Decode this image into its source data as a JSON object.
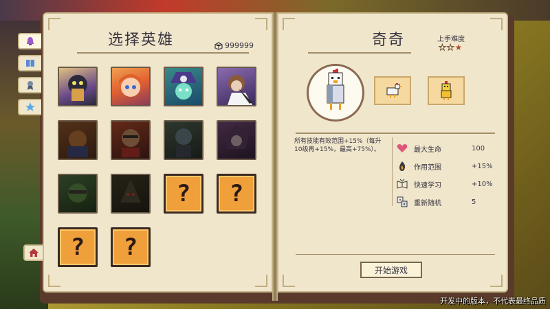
{
  "left_page": {
    "title": "选择英雄",
    "currency": {
      "icon": "crystal-icon",
      "amount": "999999"
    },
    "heroes": [
      {
        "state": "unlocked",
        "icon": "hero-1-portrait"
      },
      {
        "state": "unlocked",
        "icon": "hero-2-portrait"
      },
      {
        "state": "unlocked",
        "icon": "hero-3-portrait"
      },
      {
        "state": "unlocked",
        "icon": "hero-4-portrait"
      },
      {
        "state": "locked",
        "icon": "hero-5-portrait"
      },
      {
        "state": "locked",
        "icon": "hero-6-portrait"
      },
      {
        "state": "locked",
        "icon": "hero-7-portrait"
      },
      {
        "state": "locked",
        "icon": "hero-8-portrait"
      },
      {
        "state": "locked",
        "icon": "hero-9-portrait"
      },
      {
        "state": "locked",
        "icon": "hero-10-portrait"
      },
      {
        "state": "unknown",
        "label": "?"
      },
      {
        "state": "unknown",
        "label": "?"
      },
      {
        "state": "unknown",
        "label": "?"
      },
      {
        "state": "unknown",
        "label": "?"
      }
    ]
  },
  "side_tabs": [
    {
      "icon": "bell-icon",
      "active": true
    },
    {
      "icon": "book-icon",
      "active": false
    },
    {
      "icon": "badge-icon",
      "active": false
    },
    {
      "icon": "star-icon",
      "active": false
    }
  ],
  "home_tab": {
    "icon": "house-icon"
  },
  "right_page": {
    "hero_name": "奇奇",
    "difficulty_label": "上手难度",
    "difficulty": {
      "filled": 1,
      "total": 3
    },
    "pets": [
      {
        "icon": "chicken-icon"
      },
      {
        "icon": "yellow-chick-icon"
      }
    ],
    "description": "所有技能有效范围+15%（每升10级再+15%，最高+75%）。",
    "stats": [
      {
        "icon": "heart-icon",
        "name": "最大生命",
        "value": "100"
      },
      {
        "icon": "flame-icon",
        "name": "作用范围",
        "value": "+15%"
      },
      {
        "icon": "book-learn-icon",
        "name": "快速学习",
        "value": "+10%"
      },
      {
        "icon": "dice-icon",
        "name": "重新随机",
        "value": "5"
      }
    ],
    "start_button": "开始游戏"
  },
  "watermark": "开发中的版本，不代表最终品质",
  "colors": {
    "page": "#efe6cc",
    "unknown_slot": "#f0a03a",
    "accent_heart": "#e0567a"
  }
}
